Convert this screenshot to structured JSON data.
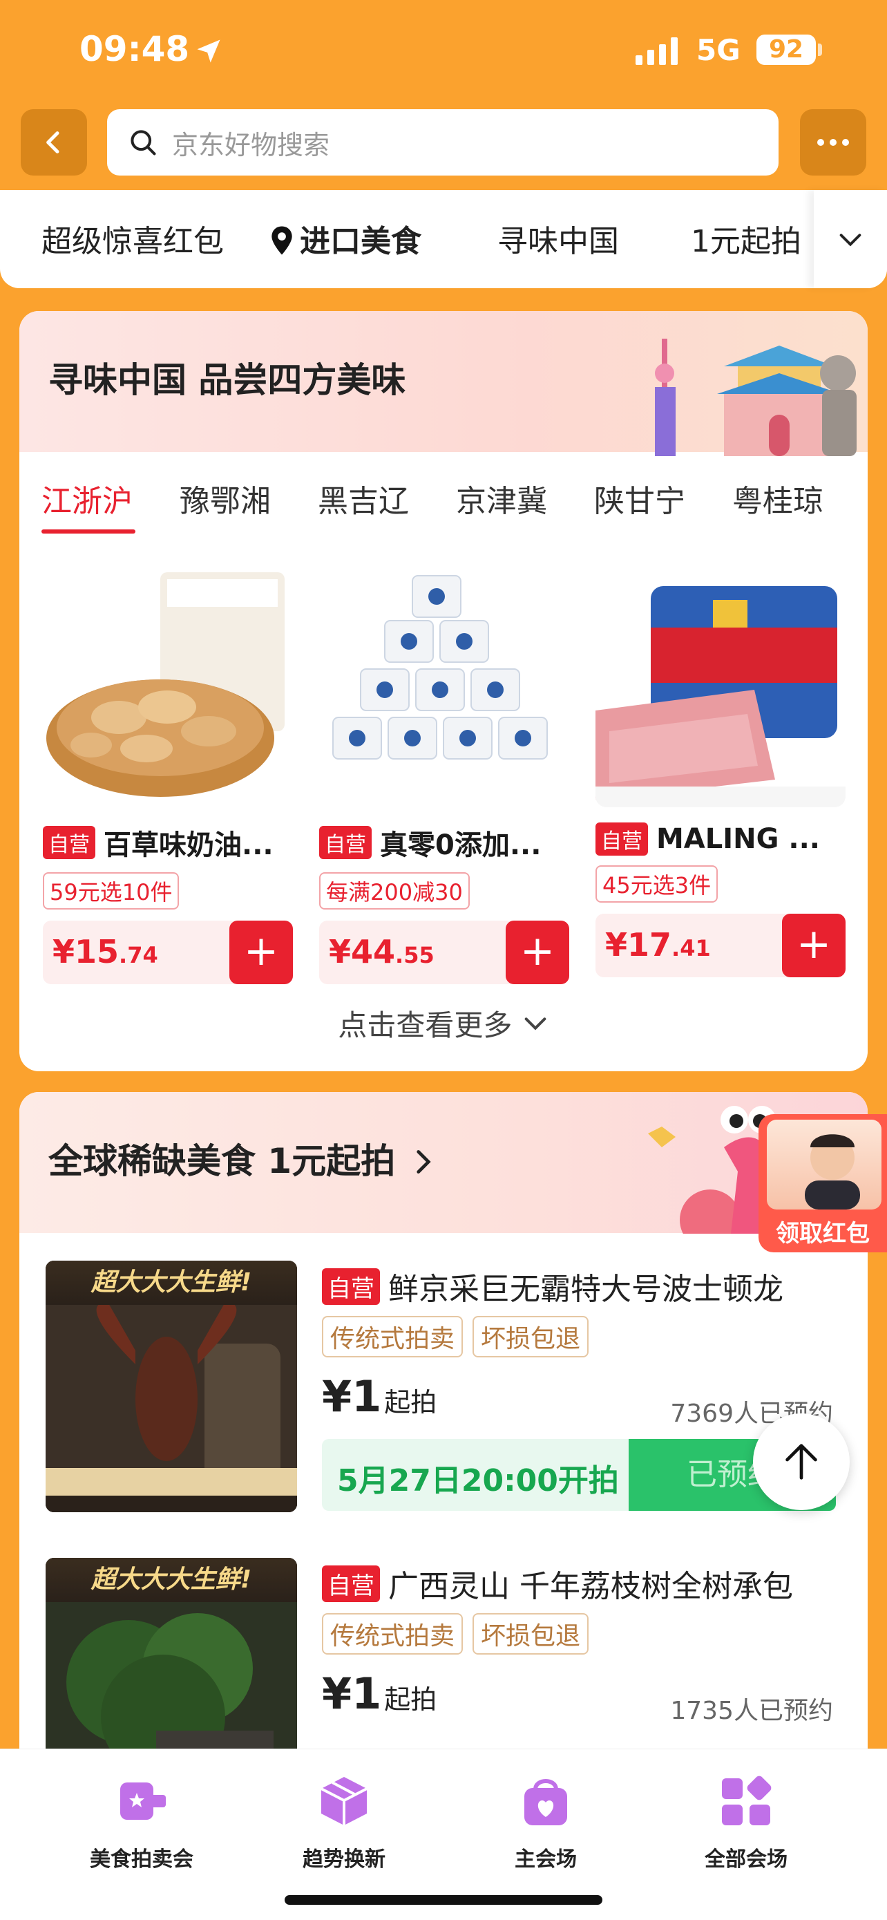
{
  "status": {
    "time": "09:48",
    "network": "5G",
    "battery": "92"
  },
  "search": {
    "placeholder": "京东好物搜索"
  },
  "categories": [
    {
      "label": "超级惊喜红包"
    },
    {
      "label": "进口美食"
    },
    {
      "label": "寻味中国"
    },
    {
      "label": "1元起拍"
    }
  ],
  "section1": {
    "title": "寻味中国 品尝四方美味",
    "regions": [
      "江浙沪",
      "豫鄂湘",
      "黑吉辽",
      "京津冀",
      "陕甘宁",
      "粤桂琼"
    ],
    "products": [
      {
        "badge": "自营",
        "name": "百草味奶油...",
        "promo": "59元选10件",
        "price_int": "¥15",
        "price_dec": ".74",
        "add": "+"
      },
      {
        "badge": "自营",
        "name": "真零0添加...",
        "promo": "每满200减30",
        "price_int": "¥44",
        "price_dec": ".55",
        "add": "+"
      },
      {
        "badge": "自营",
        "name": "MALING ...",
        "promo": "45元选3件",
        "price_int": "¥17",
        "price_dec": ".41",
        "add": "+"
      }
    ],
    "see_more": "点击查看更多"
  },
  "section2": {
    "title": "全球稀缺美食 1元起拍",
    "items": [
      {
        "thumb_banner": "超大大大生鲜!",
        "badge": "自营",
        "title": "鲜京采巨无霸特大号波士顿龙",
        "tags": [
          "传统式拍卖",
          "坏损包退"
        ],
        "price": "¥1",
        "price_suffix": "起拍",
        "count": "7369人已预约",
        "cta_time": "5月27日20:00开拍",
        "cta_btn": "已预约"
      },
      {
        "thumb_banner": "超大大大生鲜!",
        "badge": "自营",
        "title": "广西灵山 千年荔枝树全树承包",
        "tags": [
          "传统式拍卖",
          "坏损包退"
        ],
        "price": "¥1",
        "price_suffix": "起拍",
        "count": "1735人已预约"
      }
    ]
  },
  "float": {
    "redpack_label": "领取红包"
  },
  "bottom_nav": [
    {
      "label": "美食拍卖会",
      "icon": "auction-hammer-icon"
    },
    {
      "label": "趋势换新",
      "icon": "box-icon"
    },
    {
      "label": "主会场",
      "icon": "shopping-bag-heart-icon"
    },
    {
      "label": "全部会场",
      "icon": "grid-apps-icon"
    }
  ],
  "colors": {
    "brand_orange": "#fba22e",
    "accent_red": "#e8212f",
    "green": "#2ac26a",
    "nav_purple": "#b45de0"
  }
}
